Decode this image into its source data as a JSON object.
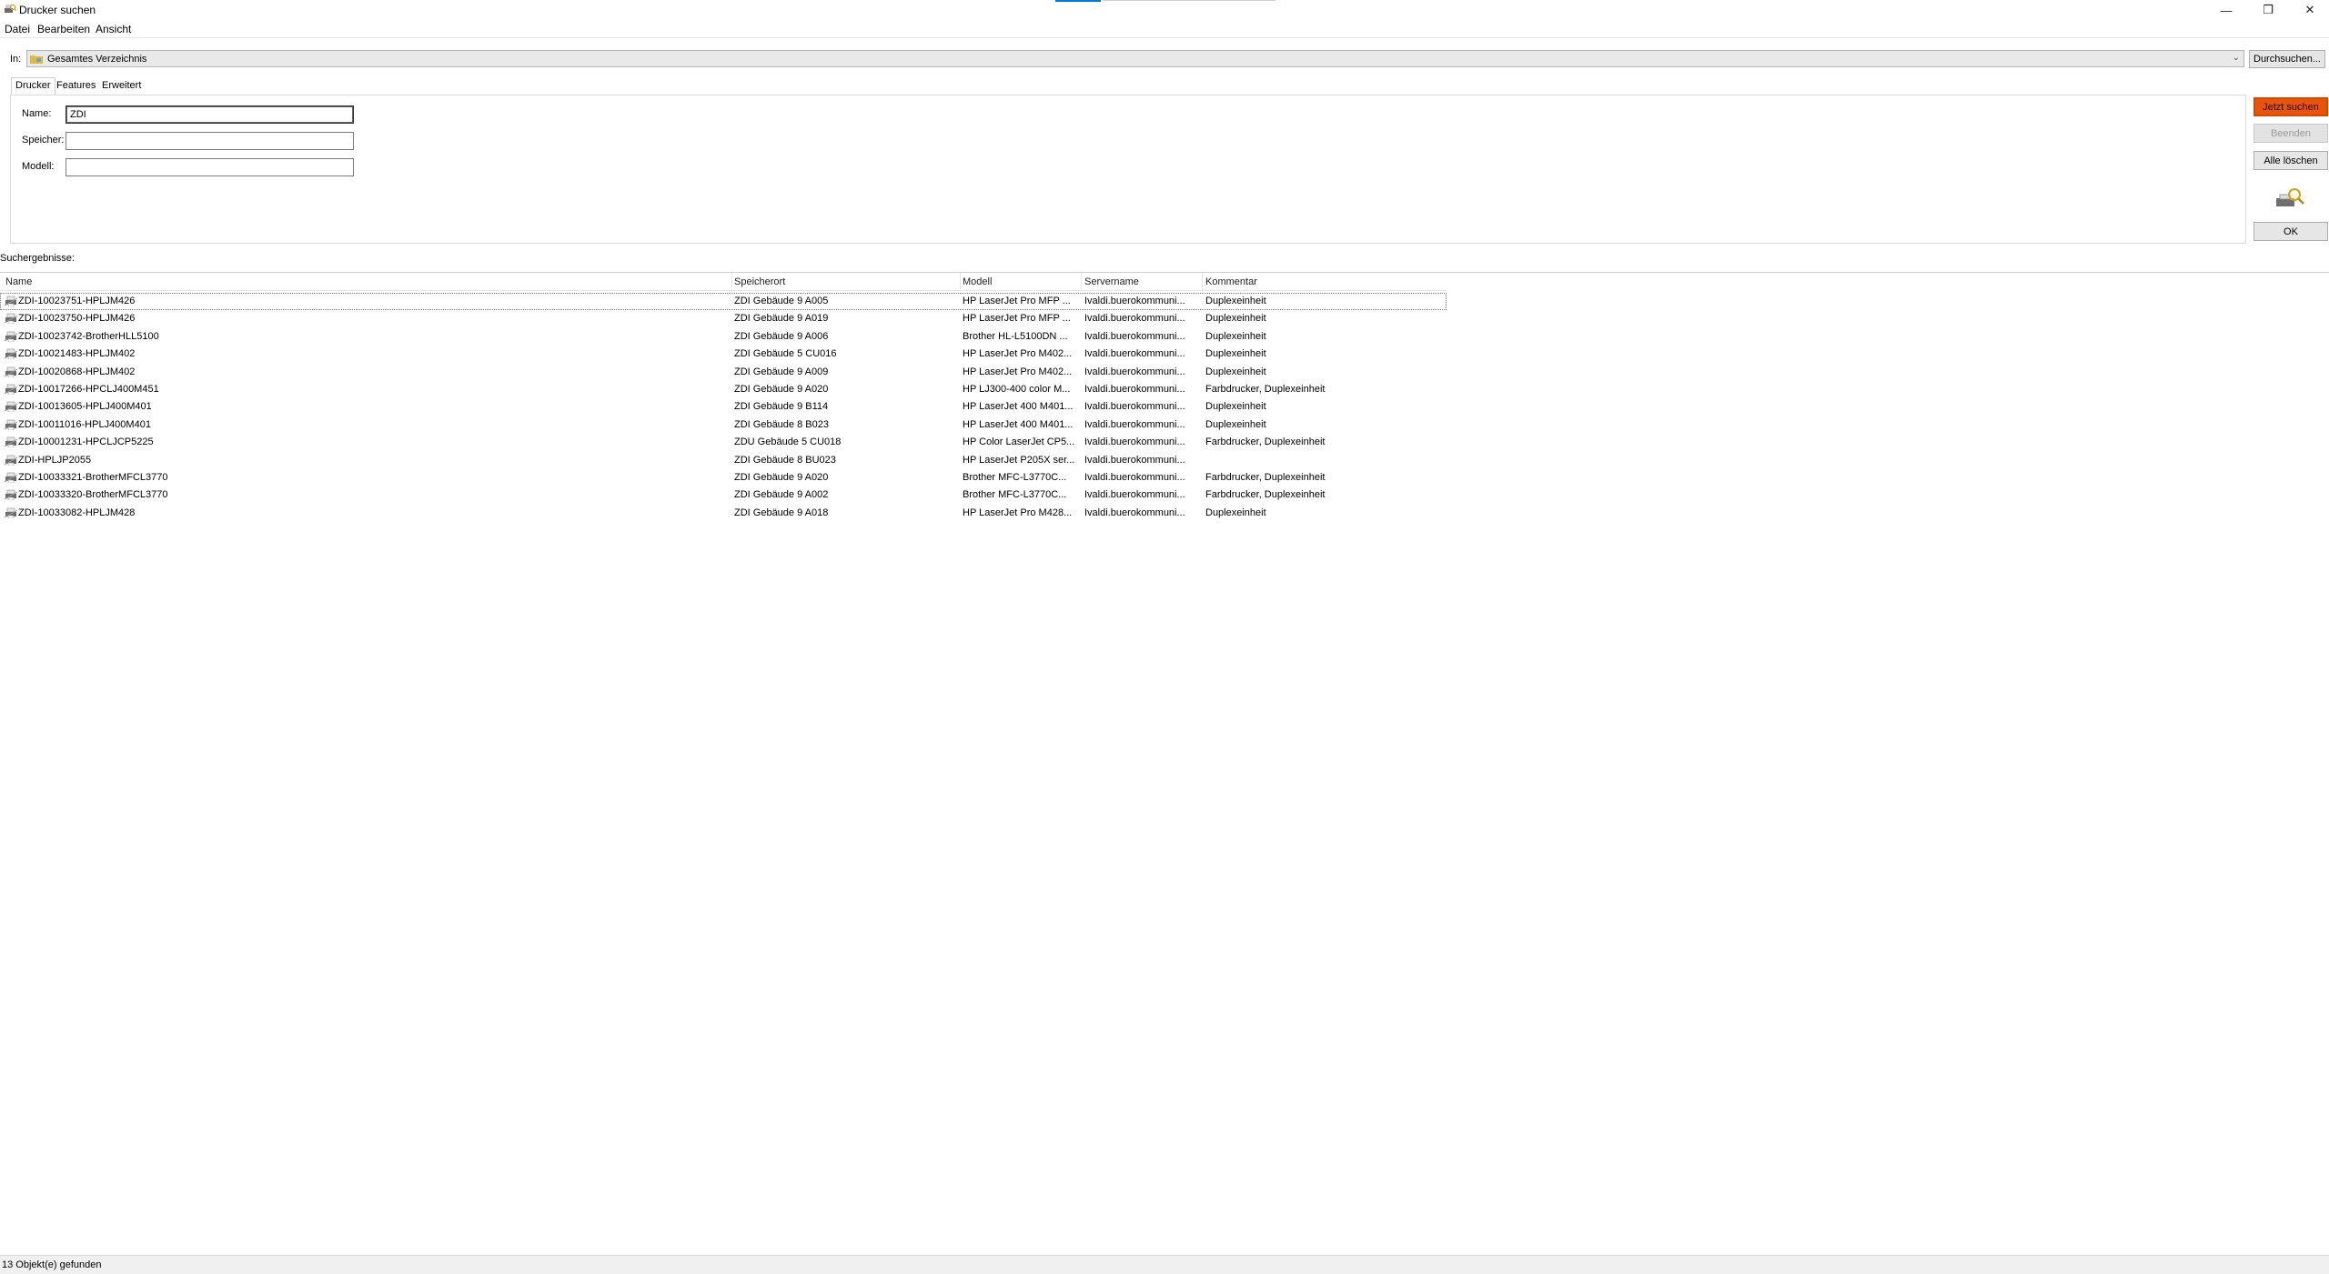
{
  "window": {
    "title": "Drucker suchen"
  },
  "window_controls": {
    "minimize": "—",
    "maximize": "❐",
    "close": "✕"
  },
  "menu": {
    "items": [
      "Datei",
      "Bearbeiten",
      "Ansicht"
    ]
  },
  "scope": {
    "label": "In:",
    "value": "Gesamtes Verzeichnis",
    "browse_label": "Durchsuchen..."
  },
  "tabs": [
    "Drucker",
    "Features",
    "Erweitert"
  ],
  "form": {
    "name_label": "Name:",
    "name_value": "ZDI",
    "location_label": "Speicher:",
    "location_value": "",
    "model_label": "Modell:",
    "model_value": ""
  },
  "actions": {
    "search": "Jetzt suchen",
    "stop": "Beenden",
    "clear": "Alle löschen",
    "ok": "OK"
  },
  "results": {
    "label": "Suchergebnisse:",
    "columns": [
      "Name",
      "Speicherort",
      "Modell",
      "Servername",
      "Kommentar"
    ],
    "rows": [
      [
        "ZDI-10023751-HPLJM426",
        "ZDI Gebäude 9 A005",
        "HP LaserJet Pro MFP ...",
        "Ivaldi.buerokommuni...",
        "Duplexeinheit"
      ],
      [
        "ZDI-10023750-HPLJM426",
        "ZDI Gebäude 9 A019",
        "HP LaserJet Pro MFP ...",
        "Ivaldi.buerokommuni...",
        "Duplexeinheit"
      ],
      [
        "ZDI-10023742-BrotherHLL5100",
        "ZDI Gebäude 9 A006",
        "Brother HL-L5100DN ...",
        "Ivaldi.buerokommuni...",
        "Duplexeinheit"
      ],
      [
        "ZDI-10021483-HPLJM402",
        "ZDI Gebäude 5 CU016",
        "HP LaserJet Pro M402...",
        "Ivaldi.buerokommuni...",
        "Duplexeinheit"
      ],
      [
        "ZDI-10020868-HPLJM402",
        "ZDI Gebäude 9 A009",
        "HP LaserJet Pro M402...",
        "Ivaldi.buerokommuni...",
        "Duplexeinheit"
      ],
      [
        "ZDI-10017266-HPCLJ400M451",
        "ZDI Gebäude 9 A020",
        "HP LJ300-400 color M...",
        "Ivaldi.buerokommuni...",
        "Farbdrucker, Duplexeinheit"
      ],
      [
        "ZDI-10013605-HPLJ400M401",
        "ZDI Gebäude 9 B114",
        "HP LaserJet 400 M401...",
        "Ivaldi.buerokommuni...",
        "Duplexeinheit"
      ],
      [
        "ZDI-10011016-HPLJ400M401",
        "ZDI Gebäude 8 B023",
        "HP LaserJet 400 M401...",
        "Ivaldi.buerokommuni...",
        "Duplexeinheit"
      ],
      [
        "ZDI-10001231-HPCLJCP5225",
        "ZDU Gebäude 5 CU018",
        "HP Color LaserJet CP5...",
        "Ivaldi.buerokommuni...",
        "Farbdrucker, Duplexeinheit"
      ],
      [
        "ZDI-HPLJP2055",
        "ZDI Gebäude 8 BU023",
        "HP LaserJet P205X ser...",
        "Ivaldi.buerokommuni...",
        ""
      ],
      [
        "ZDI-10033321-BrotherMFCL3770",
        "ZDI Gebäude 9 A020",
        "Brother MFC-L3770C...",
        "Ivaldi.buerokommuni...",
        "Farbdrucker, Duplexeinheit"
      ],
      [
        "ZDI-10033320-BrotherMFCL3770",
        "ZDI Gebäude 9 A002",
        "Brother MFC-L3770C...",
        "Ivaldi.buerokommuni...",
        "Farbdrucker, Duplexeinheit"
      ],
      [
        "ZDI-10033082-HPLJM428",
        "ZDI Gebäude 9 A018",
        "HP LaserJet Pro M428...",
        "Ivaldi.buerokommuni...",
        "Duplexeinheit"
      ]
    ]
  },
  "status": {
    "text": "13 Objekt(e) gefunden"
  },
  "icons": {
    "app": "printer-search-icon",
    "scope": "directory-folder-icon",
    "search": "magnifier-icon",
    "row": "printer-icon"
  },
  "colors": {
    "primary_button": "#e8540c",
    "focus_accent": "#0078d7"
  }
}
